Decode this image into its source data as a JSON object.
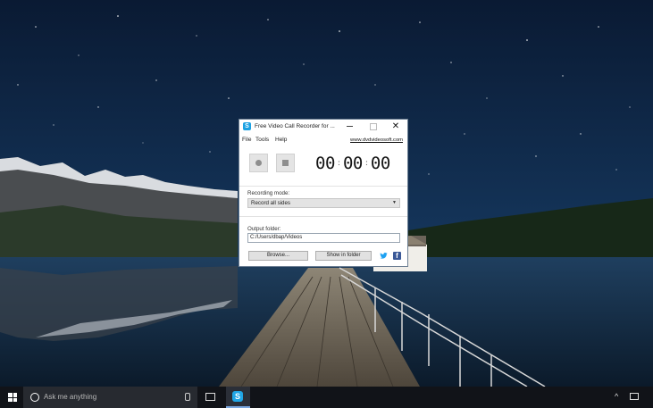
{
  "window": {
    "title": "Free Video Call Recorder for ...",
    "menu": [
      "File",
      "Tools",
      "Help"
    ],
    "link": "www.dvdvideosoft.com",
    "timer": {
      "hours": "00",
      "minutes": "00",
      "seconds": "00"
    },
    "recording_mode_label": "Recording mode:",
    "recording_mode_value": "Record all sides",
    "output_folder_label": "Output folder:",
    "output_folder_value": "C:/Users/dbap/Videos",
    "browse_label": "Browse...",
    "show_in_folder_label": "Show in folder"
  },
  "taskbar": {
    "search_placeholder": "Ask me anything"
  },
  "icons": {
    "app": "skype-icon",
    "twitter": "twitter-icon",
    "facebook": "facebook-icon",
    "start": "windows-logo-icon",
    "search": "cortana-icon",
    "mic": "microphone-icon",
    "task_view": "task-view-icon",
    "tray_expand": "chevron-up-icon",
    "notifications": "action-center-icon"
  },
  "colors": {
    "accent": "#1ba1e2",
    "facebook": "#3b5998",
    "taskbar": "#111318"
  }
}
